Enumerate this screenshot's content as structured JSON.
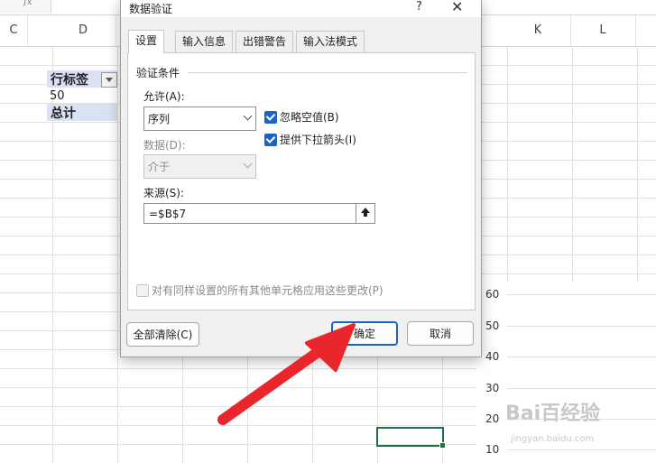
{
  "sheet": {
    "fx_label": "fx",
    "columns": {
      "c": "C",
      "d": "D",
      "k": "K",
      "l": "L"
    },
    "pivot": {
      "row_label": "行标签",
      "value": "50",
      "total": "总计"
    },
    "chart_y_ticks": [
      "60",
      "50",
      "40",
      "30",
      "20",
      "10"
    ],
    "watermark": "Bai百经验",
    "watermark_sub": "jingyan.baidu.com"
  },
  "dialog": {
    "title": "数据验证",
    "help": "?",
    "close": "✕",
    "tabs": [
      "设置",
      "输入信息",
      "出错警告",
      "输入法模式"
    ],
    "active_tab": "设置",
    "criteria_section": "验证条件",
    "allow_label": "允许(A):",
    "allow_value": "序列",
    "data_label": "数据(D):",
    "data_value": "介于",
    "ignore_blank": {
      "label": "忽略空值(B)",
      "checked": true
    },
    "dropdown_arrow": {
      "label": "提供下拉箭头(I)",
      "checked": true
    },
    "source_label": "来源(S):",
    "source_value": "=$B$7",
    "apply_all": {
      "label": "对有同样设置的所有其他单元格应用这些更改(P)",
      "checked": false
    },
    "clear_all_button": "全部清除(C)",
    "ok_button": "确定",
    "cancel_button": "取消"
  },
  "colors": {
    "accent": "#1a64c4",
    "annotation_arrow": "#e8262b",
    "selection": "#1e7145"
  }
}
